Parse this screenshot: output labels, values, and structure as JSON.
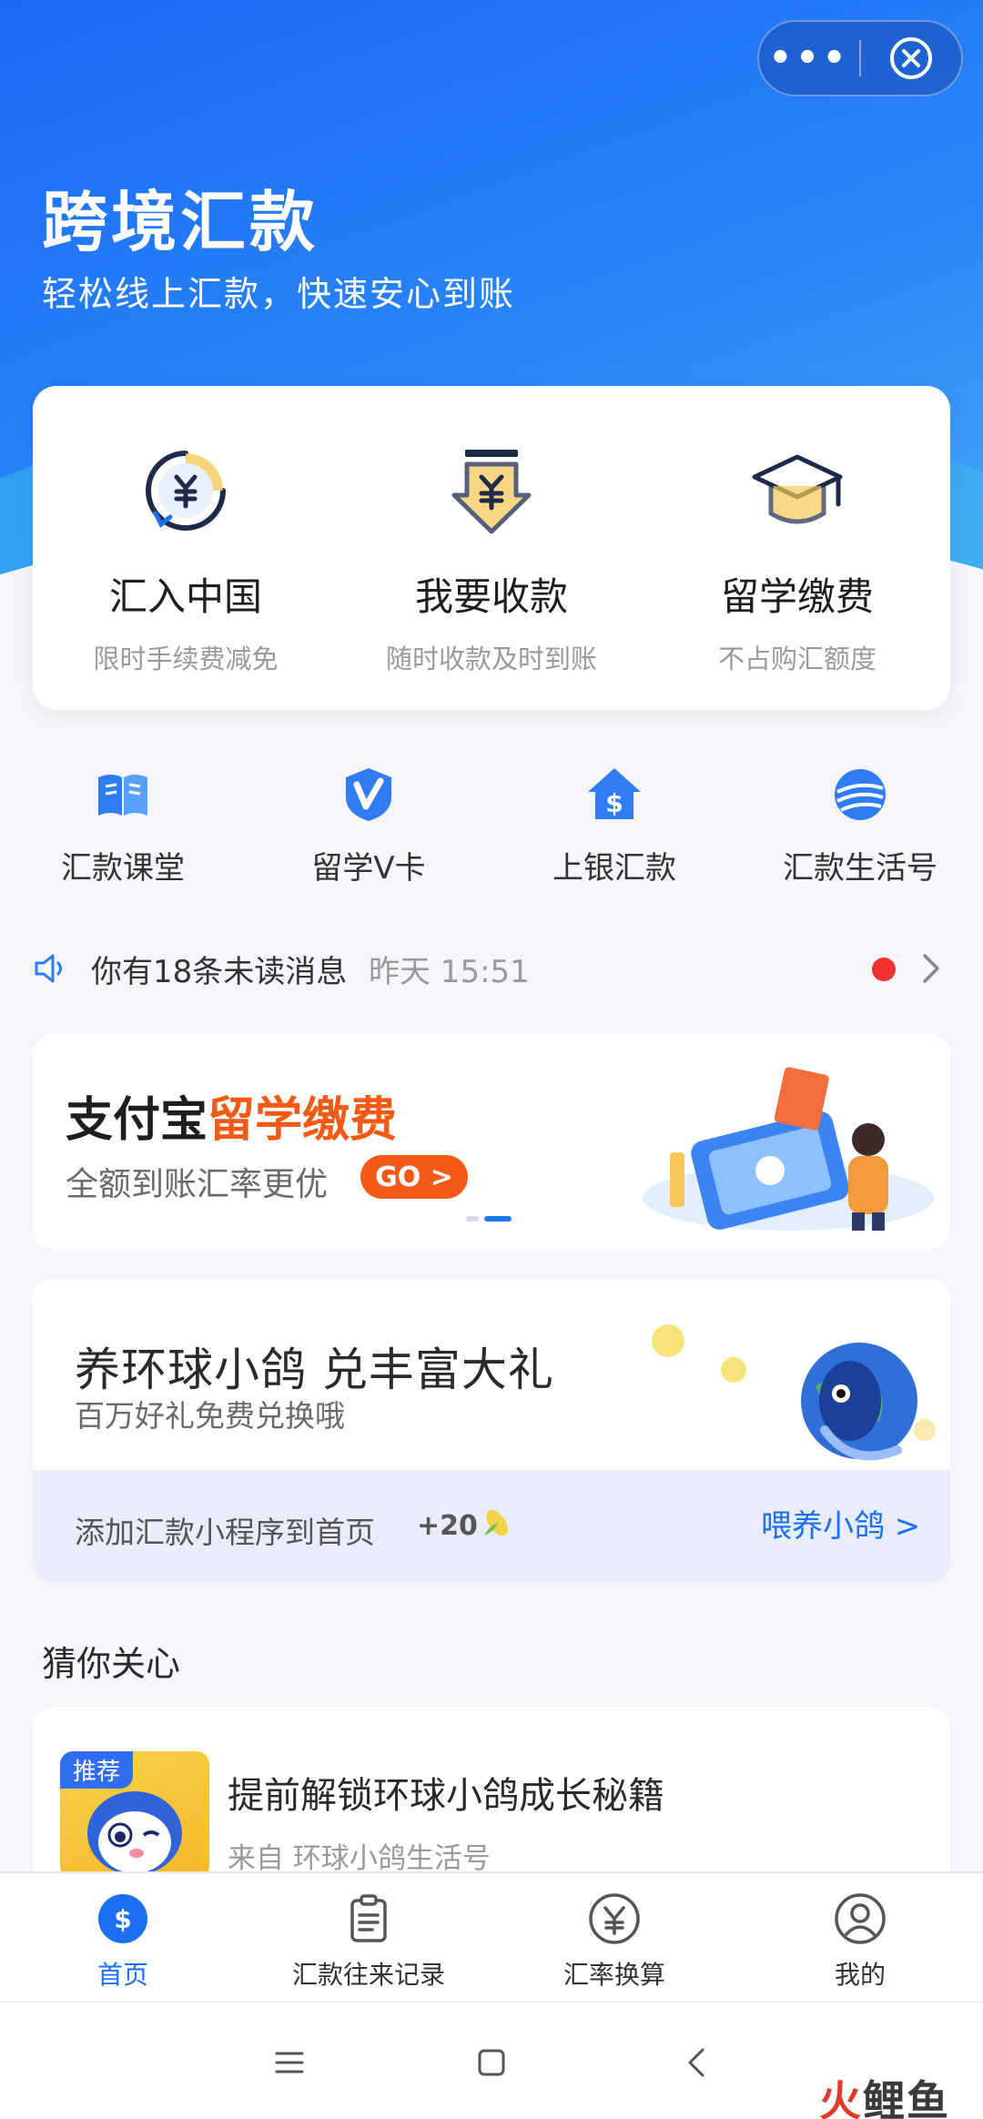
{
  "hero": {
    "title": "跨境汇款",
    "subtitle": "轻松线上汇款，快速安心到账",
    "capsule": {
      "more_label": "•••"
    }
  },
  "features": [
    {
      "title": "汇入中国",
      "subtitle": "限时手续费减免",
      "icon": "yuan-cycle-icon"
    },
    {
      "title": "我要收款",
      "subtitle": "随时收款及时到账",
      "icon": "yuan-download-icon"
    },
    {
      "title": "留学缴费",
      "subtitle": "不占购汇额度",
      "icon": "graduation-cap-icon"
    }
  ],
  "quick": [
    {
      "label": "汇款课堂",
      "icon": "book-icon"
    },
    {
      "label": "留学V卡",
      "icon": "v-card-icon"
    },
    {
      "label": "上银汇款",
      "icon": "dollar-house-icon"
    },
    {
      "label": "汇款生活号",
      "icon": "globe-icon"
    }
  ],
  "notice": {
    "message": "你有18条未读消息",
    "time": "昨天 15:51"
  },
  "banner": {
    "brand": "支付宝",
    "highlight": "留学缴费",
    "subtitle": "全额到账汇率更优",
    "go_label": "GO >"
  },
  "pigeon": {
    "title": "养环球小鸽 兑丰富大礼",
    "subtitle": "百万好礼免费兑换哦",
    "add_text": "添加汇款小程序到首页",
    "points": "+20",
    "feed_label": "喂养小鸽 >"
  },
  "guess": {
    "title": "猜你关心"
  },
  "recommend": {
    "tag": "推荐",
    "title": "提前解锁环球小鸽成长秘籍",
    "source": "来自 环球小鸽生活号"
  },
  "tabs": [
    {
      "label": "首页",
      "icon": "home-dollar-icon",
      "active": true
    },
    {
      "label": "汇款往来记录",
      "icon": "clipboard-icon",
      "active": false
    },
    {
      "label": "汇率换算",
      "icon": "yuan-circle-icon",
      "active": false
    },
    {
      "label": "我的",
      "icon": "user-icon",
      "active": false
    }
  ],
  "watermark": {
    "part1": "火",
    "part2": "鲤鱼"
  },
  "colors": {
    "primary": "#1d6ff2",
    "accent": "#f55a14",
    "badge": "#f0322e"
  }
}
